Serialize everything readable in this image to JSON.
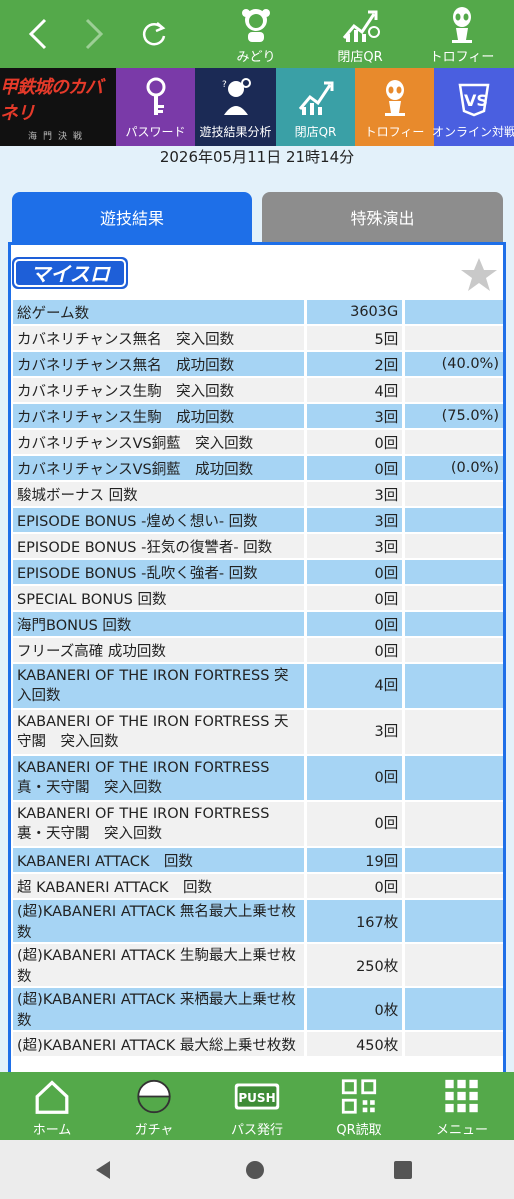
{
  "topbar": {
    "items": [
      {
        "label": "みどり"
      },
      {
        "label": "閉店QR"
      },
      {
        "label": "トロフィー"
      }
    ]
  },
  "banner": {
    "logo_text": "甲鉄城のカバネリ",
    "logo_sub": "海門決戦",
    "tiles": [
      {
        "label": "パスワード",
        "color": "#7a3aa8"
      },
      {
        "label": "遊技結果分析",
        "color": "#1b2a55"
      },
      {
        "label": "閉店QR",
        "color": "#3aa0a6"
      },
      {
        "label": "トロフィー",
        "color": "#e88a2c"
      },
      {
        "label": "オンライン対戦",
        "color": "#4a5fe0"
      }
    ]
  },
  "datetime": "2026年05月11日 21時14分",
  "tabs": [
    {
      "label": "遊技結果"
    },
    {
      "label": "特殊演出"
    }
  ],
  "panel": {
    "brand": "マイスロ"
  },
  "rows": [
    {
      "label": "総ゲーム数",
      "value": "3603G",
      "pct": ""
    },
    {
      "label": "カバネリチャンス無名　突入回数",
      "value": "5回",
      "pct": ""
    },
    {
      "label": "カバネリチャンス無名　成功回数",
      "value": "2回",
      "pct": "(40.0%)"
    },
    {
      "label": "カバネリチャンス生駒　突入回数",
      "value": "4回",
      "pct": ""
    },
    {
      "label": "カバネリチャンス生駒　成功回数",
      "value": "3回",
      "pct": "(75.0%)"
    },
    {
      "label": "カバネリチャンスVS銅藍　突入回数",
      "value": "0回",
      "pct": ""
    },
    {
      "label": "カバネリチャンスVS銅藍　成功回数",
      "value": "0回",
      "pct": "(0.0%)"
    },
    {
      "label": "駿城ボーナス 回数",
      "value": "3回",
      "pct": ""
    },
    {
      "label": "EPISODE BONUS -煌めく想い- 回数",
      "value": "3回",
      "pct": ""
    },
    {
      "label": "EPISODE BONUS -狂気の復讐者- 回数",
      "value": "3回",
      "pct": ""
    },
    {
      "label": "EPISODE BONUS -乱吹く強者- 回数",
      "value": "0回",
      "pct": ""
    },
    {
      "label": "SPECIAL BONUS 回数",
      "value": "0回",
      "pct": ""
    },
    {
      "label": "海門BONUS 回数",
      "value": "0回",
      "pct": ""
    },
    {
      "label": "フリーズ高確 成功回数",
      "value": "0回",
      "pct": ""
    },
    {
      "label": "KABANERI OF THE IRON FORTRESS 突入回数",
      "value": "4回",
      "pct": ""
    },
    {
      "label": "KABANERI OF THE IRON FORTRESS 天守閣　突入回数",
      "value": "3回",
      "pct": ""
    },
    {
      "label": "KABANERI OF THE IRON FORTRESS 真・天守閣　突入回数",
      "value": "0回",
      "pct": ""
    },
    {
      "label": "KABANERI OF THE IRON FORTRESS 裏・天守閣　突入回数",
      "value": "0回",
      "pct": ""
    },
    {
      "label": "KABANERI ATTACK　回数",
      "value": "19回",
      "pct": ""
    },
    {
      "label": "超 KABANERI ATTACK　回数",
      "value": "0回",
      "pct": ""
    },
    {
      "label": "(超)KABANERI ATTACK 無名最大上乗せ枚数",
      "value": "167枚",
      "pct": ""
    },
    {
      "label": "(超)KABANERI ATTACK 生駒最大上乗せ枚数",
      "value": "250枚",
      "pct": ""
    },
    {
      "label": "(超)KABANERI ATTACK 来栖最大上乗せ枚数",
      "value": "0枚",
      "pct": ""
    },
    {
      "label": "(超)KABANERI ATTACK 最大総上乗せ枚数",
      "value": "450枚",
      "pct": ""
    }
  ],
  "bottombar": {
    "items": [
      {
        "label": "ホーム"
      },
      {
        "label": "ガチャ"
      },
      {
        "label": "パス発行"
      },
      {
        "label": "QR読取"
      },
      {
        "label": "メニュー"
      }
    ],
    "push_text": "PUSH"
  },
  "colors": {
    "green": "#54a94a",
    "tab_active": "#1e6fe8",
    "tab_inactive": "#8d8d8d",
    "row_blue": "#a6d4f4",
    "row_gray": "#f1f1f1"
  }
}
